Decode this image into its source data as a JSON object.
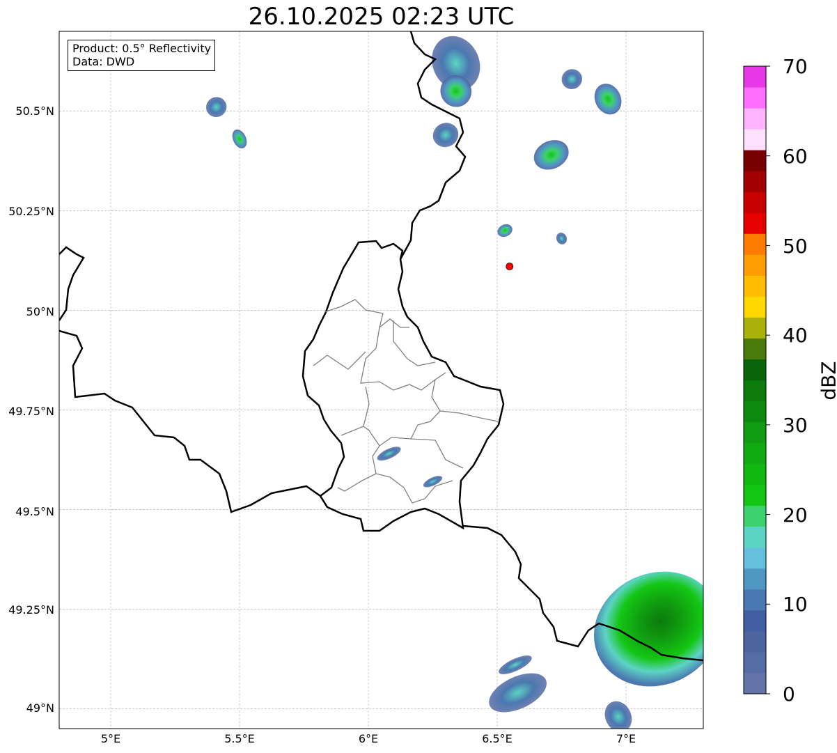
{
  "title": "26.10.2025 02:23 UTC",
  "info": {
    "product": "Product: 0.5° Reflectivity",
    "source": "Data: DWD"
  },
  "axes": {
    "x_ticks": [
      {
        "value": 5.0,
        "label": "5°E"
      },
      {
        "value": 5.5,
        "label": "5.5°E"
      },
      {
        "value": 6.0,
        "label": "6°E"
      },
      {
        "value": 6.5,
        "label": "6.5°E"
      },
      {
        "value": 7.0,
        "label": "7°E"
      }
    ],
    "y_ticks": [
      {
        "value": 50.5,
        "label": "50.5°N"
      },
      {
        "value": 50.25,
        "label": "50.25°N"
      },
      {
        "value": 50.0,
        "label": "50°N"
      },
      {
        "value": 49.75,
        "label": "49.75°N"
      },
      {
        "value": 49.5,
        "label": "49.5°N"
      },
      {
        "value": 49.25,
        "label": "49.25°N"
      },
      {
        "value": 49.0,
        "label": "49°N"
      }
    ],
    "lon_range": [
      4.8,
      7.3
    ],
    "lat_range": [
      48.95,
      50.7
    ],
    "grid": true
  },
  "radar_site": {
    "lon": 6.548,
    "lat": 50.11,
    "color": "#ff0000"
  },
  "colorbar": {
    "label": "dBZ",
    "range": [
      0,
      70
    ],
    "tick_labels": [
      "0",
      "10",
      "20",
      "30",
      "40",
      "50",
      "60",
      "70"
    ],
    "colors": [
      "#6474a8",
      "#566ca4",
      "#4d64a0",
      "#445ea2",
      "#4a78b0",
      "#5098c4",
      "#64c0dc",
      "#5cd4c4",
      "#3cd26e",
      "#14c614",
      "#10b810",
      "#12aa12",
      "#109c10",
      "#0e8a0e",
      "#0c7a0c",
      "#0a640a",
      "#4a7a0a",
      "#aab20a",
      "#ffd800",
      "#ffbc00",
      "#ff9e00",
      "#ff7c00",
      "#e60000",
      "#c80000",
      "#a00000",
      "#780000",
      "#ffe0ff",
      "#ffb4ff",
      "#ff6eff",
      "#e638e6"
    ]
  },
  "echoes": [
    {
      "lon": 6.34,
      "lat": 50.62,
      "rx": 0.09,
      "ry": 0.07,
      "level": "weak"
    },
    {
      "lon": 6.34,
      "lat": 50.55,
      "rx": 0.06,
      "ry": 0.04,
      "level": "moderate"
    },
    {
      "lon": 6.3,
      "lat": 50.44,
      "rx": 0.05,
      "ry": 0.03,
      "level": "weak"
    },
    {
      "lon": 5.41,
      "lat": 50.51,
      "rx": 0.04,
      "ry": 0.025,
      "level": "weak"
    },
    {
      "lon": 5.5,
      "lat": 50.43,
      "rx": 0.025,
      "ry": 0.025,
      "level": "moderate"
    },
    {
      "lon": 6.71,
      "lat": 50.39,
      "rx": 0.07,
      "ry": 0.035,
      "level": "moderate"
    },
    {
      "lon": 6.79,
      "lat": 50.58,
      "rx": 0.04,
      "ry": 0.025,
      "level": "weak"
    },
    {
      "lon": 6.93,
      "lat": 50.53,
      "rx": 0.05,
      "ry": 0.04,
      "level": "moderate"
    },
    {
      "lon": 6.53,
      "lat": 50.2,
      "rx": 0.03,
      "ry": 0.015,
      "level": "moderate"
    },
    {
      "lon": 6.75,
      "lat": 50.18,
      "rx": 0.02,
      "ry": 0.015,
      "level": "weak"
    },
    {
      "lon": 6.08,
      "lat": 49.64,
      "rx": 0.05,
      "ry": 0.012,
      "level": "weak"
    },
    {
      "lon": 6.25,
      "lat": 49.57,
      "rx": 0.04,
      "ry": 0.01,
      "level": "weak"
    },
    {
      "lon": 7.12,
      "lat": 49.2,
      "rx": 0.25,
      "ry": 0.14,
      "level": "strong"
    },
    {
      "lon": 6.58,
      "lat": 49.04,
      "rx": 0.12,
      "ry": 0.04,
      "level": "weak"
    },
    {
      "lon": 6.97,
      "lat": 48.98,
      "rx": 0.05,
      "ry": 0.04,
      "level": "weak"
    },
    {
      "lon": 6.57,
      "lat": 49.11,
      "rx": 0.07,
      "ry": 0.015,
      "level": "weak"
    }
  ]
}
